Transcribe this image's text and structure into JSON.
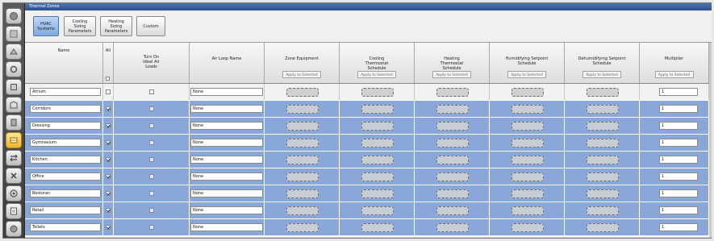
{
  "window": {
    "title": "Thermal Zones"
  },
  "sidebar": {
    "icons": [
      "site-icon",
      "schedules-icon",
      "constructions-icon",
      "loads-icon",
      "space-types-icon",
      "geometry-icon",
      "facility-icon",
      "thermal-zones-icon",
      "hvac-systems-icon",
      "building-summary-icon",
      "measures-icon",
      "simulation-icon",
      "results-icon"
    ],
    "active_index": 7
  },
  "toolbar": {
    "buttons": [
      {
        "label": "HVAC Systems",
        "active": true
      },
      {
        "label": "Cooling Sizing Parameters",
        "active": false
      },
      {
        "label": "Heating Sizing Parameters",
        "active": false
      },
      {
        "label": "Custom",
        "active": false
      }
    ]
  },
  "table": {
    "headers": {
      "name": "Name",
      "all": "All",
      "ideal_loads": "Turn On Ideal Air Loads",
      "air_loop": "Air Loop Name",
      "zone_equipment": "Zone Equipment",
      "cooling_schedule": "Cooling Thermostat Schedule",
      "heating_schedule": "Heating Thermostat Schedule",
      "humidifying": "Humidifying Setpoint Schedule",
      "dehumidifying": "Dehumidifying Setpoint Schedule",
      "multiplier": "Multiplier"
    },
    "apply_label": "Apply to Selected",
    "rows": [
      {
        "name": "Atrium",
        "selected": false,
        "air_loop": "None",
        "multiplier": "1"
      },
      {
        "name": "Corridors",
        "selected": true,
        "air_loop": "None",
        "multiplier": "1"
      },
      {
        "name": "Dressing",
        "selected": true,
        "air_loop": "None",
        "multiplier": "1"
      },
      {
        "name": "Gymnasium",
        "selected": true,
        "air_loop": "None",
        "multiplier": "1"
      },
      {
        "name": "Kitchen",
        "selected": true,
        "air_loop": "None",
        "multiplier": "1"
      },
      {
        "name": "Office",
        "selected": true,
        "air_loop": "None",
        "multiplier": "1"
      },
      {
        "name": "Restoran",
        "selected": true,
        "air_loop": "None",
        "multiplier": "1"
      },
      {
        "name": "Retail",
        "selected": true,
        "air_loop": "None",
        "multiplier": "1"
      },
      {
        "name": "Toilets",
        "selected": true,
        "air_loop": "None",
        "multiplier": "1"
      }
    ]
  },
  "colors": {
    "selected_row": "#8aa7d9",
    "titlebar": "#2c4f90",
    "active_tool": "#7fa9e0"
  }
}
